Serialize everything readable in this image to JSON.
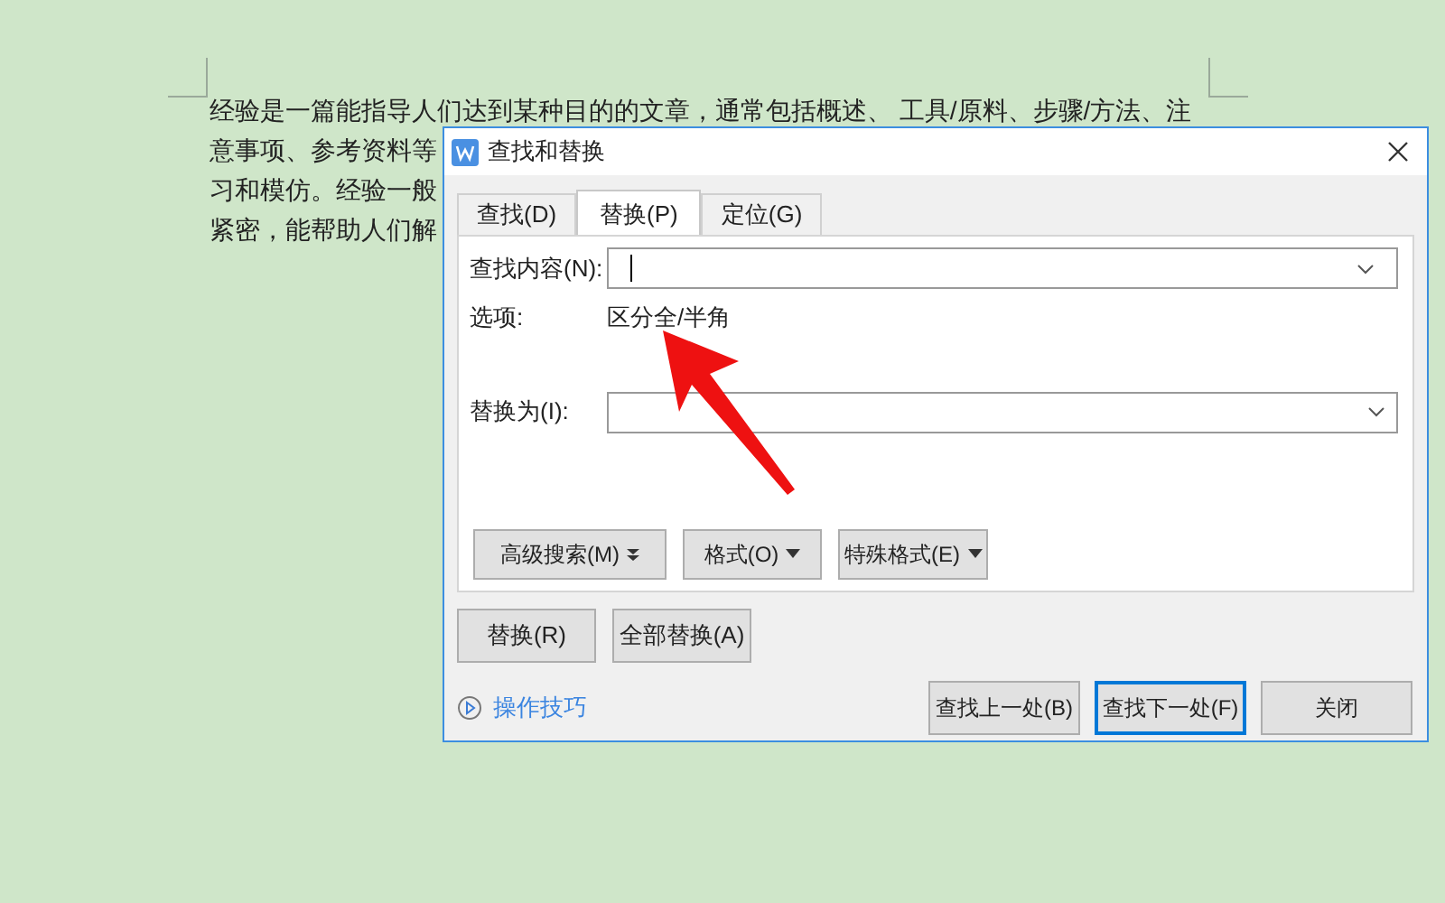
{
  "document": {
    "lines": [
      "经验是一篇能指导人们达到某种目的的文章，通常包括概述、 工具/原料、步骤/方法、注",
      "意事项、参考资料等",
      "习和模仿。经验一般",
      "紧密，能帮助人们解"
    ]
  },
  "dialog": {
    "title": "查找和替换",
    "tabs": [
      {
        "label": "查找(D)",
        "selected": false
      },
      {
        "label": "替换(P)",
        "selected": true
      },
      {
        "label": "定位(G)",
        "selected": false
      }
    ],
    "find_field": {
      "label": "查找内容(N):",
      "focused": true
    },
    "options": {
      "label": "选项:",
      "value": "区分全/半角"
    },
    "replace_field": {
      "label": "替换为(I):"
    },
    "option_buttons": [
      {
        "label": "高级搜索(M)",
        "kind": "double"
      },
      {
        "label": "格式(O)",
        "kind": "single"
      },
      {
        "label": "特殊格式(E)",
        "kind": "single"
      }
    ],
    "replace_buttons": [
      "替换(R)",
      "全部替换(A)"
    ],
    "help_link": "操作技巧",
    "buttons": [
      {
        "label": "查找上一处(B)",
        "default": false
      },
      {
        "label": "查找下一处(F)",
        "default": true
      },
      {
        "label": "关闭",
        "default": false
      }
    ]
  }
}
